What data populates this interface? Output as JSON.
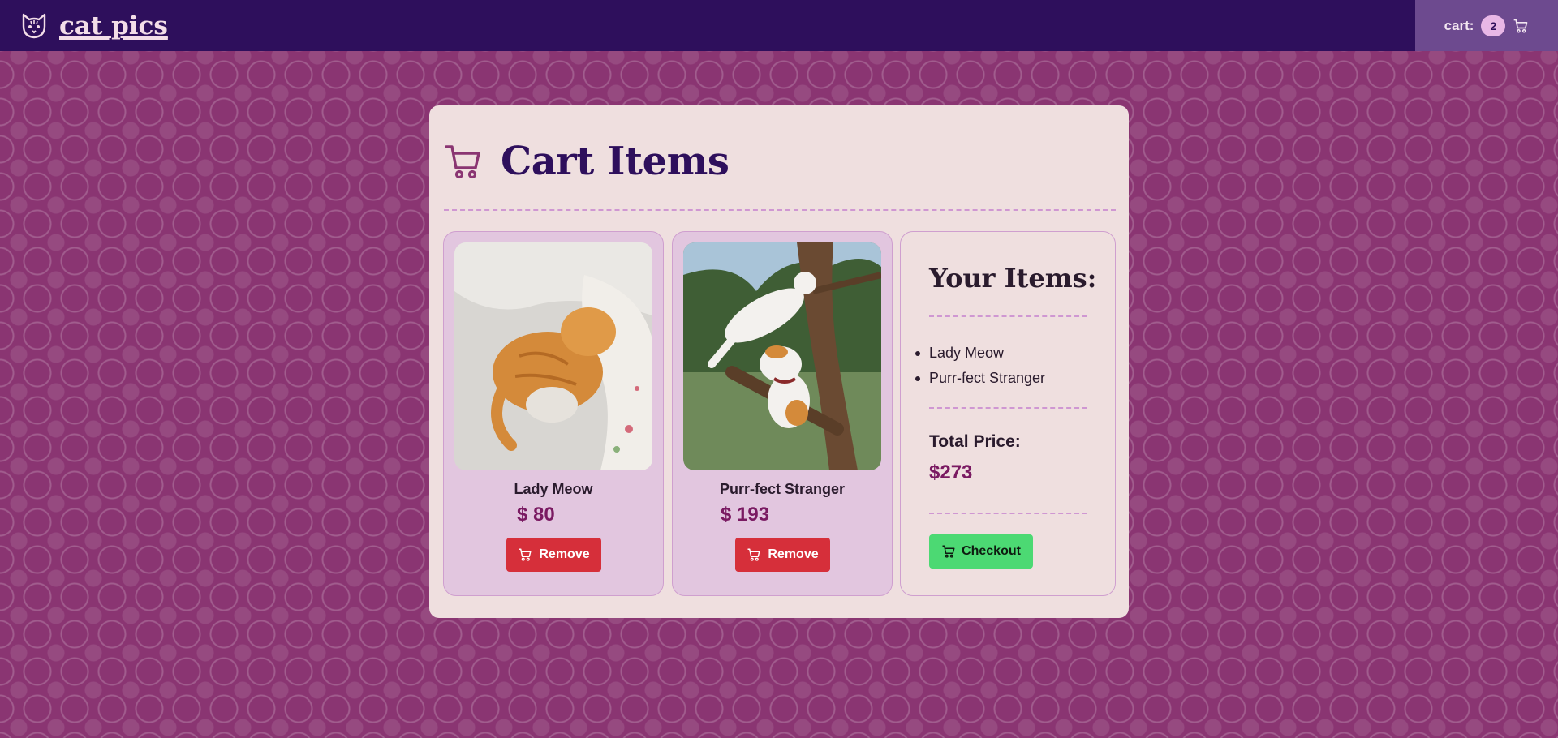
{
  "header": {
    "brand": "cat pics",
    "brand_icon": "cat-face-icon",
    "cart_label": "cart:",
    "cart_count": "2",
    "cart_icon": "cart-icon"
  },
  "panel": {
    "title": "Cart Items",
    "title_icon": "cart-icon"
  },
  "items": [
    {
      "name": "Lady Meow",
      "price": "$ 80",
      "remove_label": "Remove",
      "image": "orange cat sleeping on pillow"
    },
    {
      "name": "Purr-fect Stranger",
      "price": "$ 193",
      "remove_label": "Remove",
      "image": "white cats climbing tree"
    }
  ],
  "summary": {
    "title": "Your Items:",
    "list": [
      "Lady Meow",
      "Purr-fect Stranger"
    ],
    "total_label": "Total Price:",
    "total_value": "$273",
    "checkout_label": "Checkout"
  },
  "colors": {
    "header_bg": "#2e0f5c",
    "page_bg": "#8a3572",
    "panel_bg": "#efdfdf",
    "price": "#7a1a62",
    "remove": "#d62f3a",
    "checkout": "#4cd973"
  }
}
